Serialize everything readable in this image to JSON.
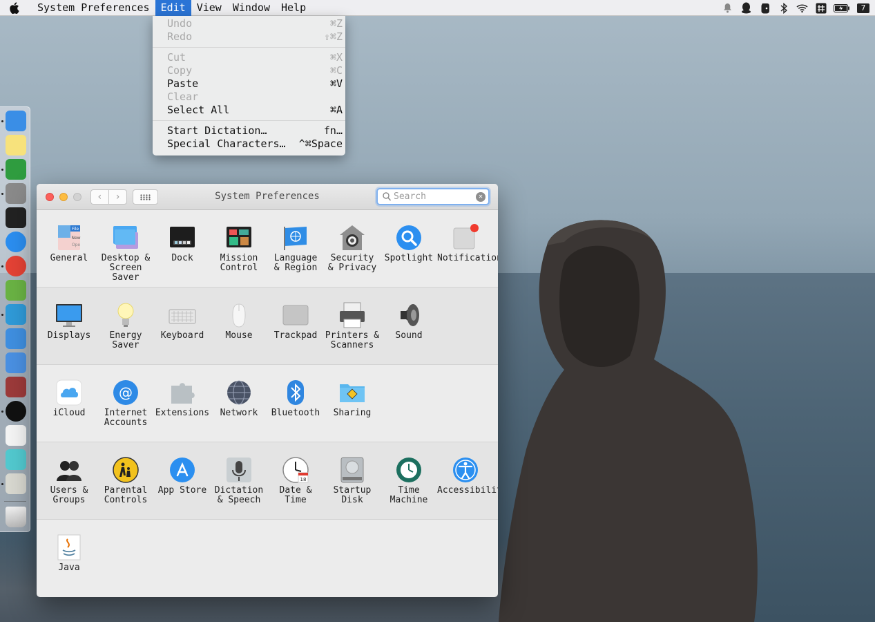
{
  "menubar": {
    "app_name": "System Preferences",
    "menus": [
      "Edit",
      "View",
      "Window",
      "Help"
    ],
    "active_menu": "Edit",
    "status_badge": "7"
  },
  "edit_menu": {
    "groups": [
      [
        {
          "label": "Undo",
          "shortcut": "⌘Z",
          "enabled": false
        },
        {
          "label": "Redo",
          "shortcut": "⇧⌘Z",
          "enabled": false
        }
      ],
      [
        {
          "label": "Cut",
          "shortcut": "⌘X",
          "enabled": false
        },
        {
          "label": "Copy",
          "shortcut": "⌘C",
          "enabled": false
        },
        {
          "label": "Paste",
          "shortcut": "⌘V",
          "enabled": true
        },
        {
          "label": "Clear",
          "shortcut": "",
          "enabled": false
        },
        {
          "label": "Select All",
          "shortcut": "⌘A",
          "enabled": true
        }
      ],
      [
        {
          "label": "Start Dictation…",
          "shortcut": "fn…",
          "enabled": true
        },
        {
          "label": "Special Characters…",
          "shortcut": "^⌘Space",
          "enabled": true
        }
      ]
    ]
  },
  "window": {
    "title": "System Preferences",
    "search_placeholder": "Search",
    "sections": [
      [
        {
          "name": "general",
          "label": "General",
          "icon": "general-icon"
        },
        {
          "name": "desktop-screen-saver",
          "label": "Desktop &\nScreen Saver",
          "icon": "desktop-icon"
        },
        {
          "name": "dock",
          "label": "Dock",
          "icon": "dock-icon"
        },
        {
          "name": "mission-control",
          "label": "Mission\nControl",
          "icon": "mission-control-icon"
        },
        {
          "name": "language-region",
          "label": "Language\n& Region",
          "icon": "flag-icon"
        },
        {
          "name": "security-privacy",
          "label": "Security\n& Privacy",
          "icon": "house-lock-icon"
        },
        {
          "name": "spotlight",
          "label": "Spotlight",
          "icon": "magnifier-icon"
        },
        {
          "name": "notifications",
          "label": "Notifications",
          "icon": "notifications-icon"
        }
      ],
      [
        {
          "name": "displays",
          "label": "Displays",
          "icon": "monitor-icon"
        },
        {
          "name": "energy-saver",
          "label": "Energy\nSaver",
          "icon": "lightbulb-icon"
        },
        {
          "name": "keyboard",
          "label": "Keyboard",
          "icon": "keyboard-icon"
        },
        {
          "name": "mouse",
          "label": "Mouse",
          "icon": "mouse-icon"
        },
        {
          "name": "trackpad",
          "label": "Trackpad",
          "icon": "trackpad-icon"
        },
        {
          "name": "printers-scanners",
          "label": "Printers &\nScanners",
          "icon": "printer-icon"
        },
        {
          "name": "sound",
          "label": "Sound",
          "icon": "speaker-icon"
        }
      ],
      [
        {
          "name": "icloud",
          "label": "iCloud",
          "icon": "cloud-icon"
        },
        {
          "name": "internet-accounts",
          "label": "Internet\nAccounts",
          "icon": "at-sign-icon"
        },
        {
          "name": "extensions",
          "label": "Extensions",
          "icon": "puzzle-icon"
        },
        {
          "name": "network",
          "label": "Network",
          "icon": "globe-icon"
        },
        {
          "name": "bluetooth",
          "label": "Bluetooth",
          "icon": "bluetooth-icon"
        },
        {
          "name": "sharing",
          "label": "Sharing",
          "icon": "sharing-folder-icon"
        }
      ],
      [
        {
          "name": "users-groups",
          "label": "Users &\nGroups",
          "icon": "users-icon"
        },
        {
          "name": "parental-controls",
          "label": "Parental\nControls",
          "icon": "parental-icon"
        },
        {
          "name": "app-store",
          "label": "App Store",
          "icon": "app-store-icon"
        },
        {
          "name": "dictation-speech",
          "label": "Dictation\n& Speech",
          "icon": "microphone-icon"
        },
        {
          "name": "date-time",
          "label": "Date & Time",
          "icon": "clock-icon"
        },
        {
          "name": "startup-disk",
          "label": "Startup\nDisk",
          "icon": "hard-disk-icon"
        },
        {
          "name": "time-machine",
          "label": "Time\nMachine",
          "icon": "time-machine-icon"
        },
        {
          "name": "accessibility",
          "label": "Accessibility",
          "icon": "accessibility-icon"
        }
      ],
      [
        {
          "name": "java",
          "label": "Java",
          "icon": "java-icon"
        }
      ]
    ]
  },
  "dock": {
    "items": [
      {
        "name": "finder",
        "icon": "finder-icon",
        "color": "#3a8ee6",
        "running": true
      },
      {
        "name": "notes",
        "icon": "notes-icon",
        "color": "#f7e27c",
        "running": false
      },
      {
        "name": "evernote",
        "icon": "evernote-icon",
        "color": "#2f9c3f",
        "running": true
      },
      {
        "name": "system-preferences",
        "icon": "gear-icon",
        "color": "#8a8a8a",
        "running": true
      },
      {
        "name": "terminal",
        "icon": "terminal-icon",
        "color": "#222222",
        "running": false
      },
      {
        "name": "safari",
        "icon": "compass-icon",
        "color": "#2b8ef0",
        "running": false
      },
      {
        "name": "chrome",
        "icon": "chrome-icon",
        "color": "#e44235",
        "running": true
      },
      {
        "name": "android-studio",
        "icon": "android-studio-icon",
        "color": "#6ab344",
        "running": false
      },
      {
        "name": "intellij",
        "icon": "intellij-icon",
        "color": "#2f9ad8",
        "running": true
      },
      {
        "name": "xcode",
        "icon": "hammer-icon",
        "color": "#3f8fe0",
        "running": false
      },
      {
        "name": "simulator",
        "icon": "simulator-icon",
        "color": "#4a90e2",
        "running": false
      },
      {
        "name": "dictionary",
        "icon": "dictionary-icon",
        "color": "#9c3a3a",
        "running": false
      },
      {
        "name": "qq",
        "icon": "penguin-icon",
        "color": "#111111",
        "running": true
      },
      {
        "name": "launchpad-grid",
        "icon": "grid-icon",
        "color": "#f4f4f4",
        "running": false
      },
      {
        "name": "maps-m",
        "icon": "m-logo-icon",
        "color": "#52c9cf",
        "running": false
      },
      {
        "name": "font-book",
        "icon": "font-icon",
        "color": "#d8d8d0",
        "running": true
      },
      {
        "name": "trash",
        "icon": "trash-icon",
        "color": "#cfcfcf",
        "running": false
      }
    ]
  }
}
